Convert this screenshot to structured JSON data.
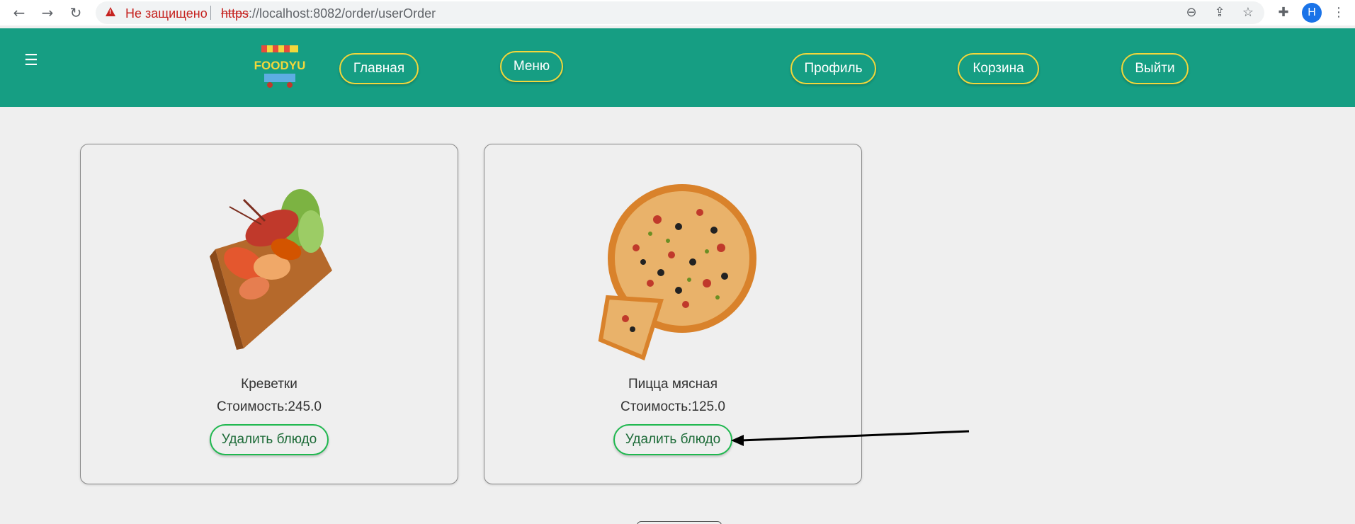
{
  "browser": {
    "security_label": "Не защищено",
    "url_protocol": "https",
    "url_rest": "://localhost:8082/order/userOrder",
    "profile_initial": "H",
    "icons": [
      "back-icon",
      "forward-icon",
      "reload-icon",
      "zoom-icon",
      "share-icon",
      "star-icon",
      "extensions-icon",
      "more-icon"
    ]
  },
  "header": {
    "logo_text": "FOODYU",
    "nav": {
      "home": "Главная",
      "menu": "Меню",
      "profile": "Профиль",
      "cart": "Корзина",
      "logout": "Выйти"
    },
    "colors": {
      "background": "#169e83",
      "pill_border": "#f2d73b"
    }
  },
  "orders": [
    {
      "name": "Креветки",
      "price_label": "Стоимость:",
      "price": "245.0",
      "delete_label": "Удалить блюдо"
    },
    {
      "name": "Пицца мясная",
      "price_label": "Стоимость:",
      "price": "125.0",
      "delete_label": "Удалить блюдо"
    }
  ],
  "accent_colors": {
    "delete_border": "#1fb84f"
  }
}
